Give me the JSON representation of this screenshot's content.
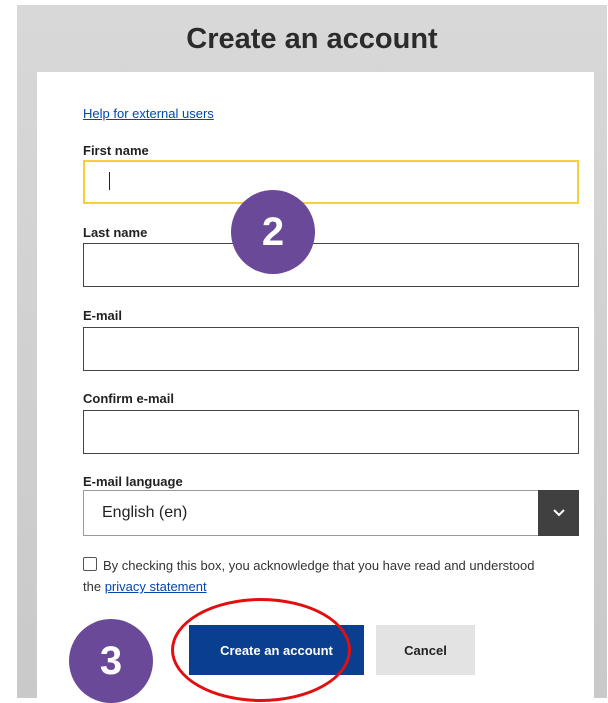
{
  "dialog": {
    "title": "Create an account",
    "help_link": "Help for external users"
  },
  "form": {
    "first_name": {
      "label": "First name",
      "value": ""
    },
    "last_name": {
      "label": "Last name",
      "value": ""
    },
    "email": {
      "label": "E-mail",
      "value": ""
    },
    "confirm_email": {
      "label": "Confirm e-mail",
      "value": ""
    },
    "email_language": {
      "label": "E-mail language",
      "selected": "English (en)"
    }
  },
  "consent": {
    "text": "By checking this box, you acknowledge that you have read and understood the",
    "link": "privacy statement",
    "checked": false
  },
  "buttons": {
    "create": "Create an account",
    "cancel": "Cancel"
  },
  "annotations": {
    "step_2": "2",
    "step_3": "3"
  },
  "colors": {
    "primary": "#0a3e8f",
    "focus": "#f4cf3f",
    "badge": "#6a4a98",
    "highlight": "#e01010"
  }
}
